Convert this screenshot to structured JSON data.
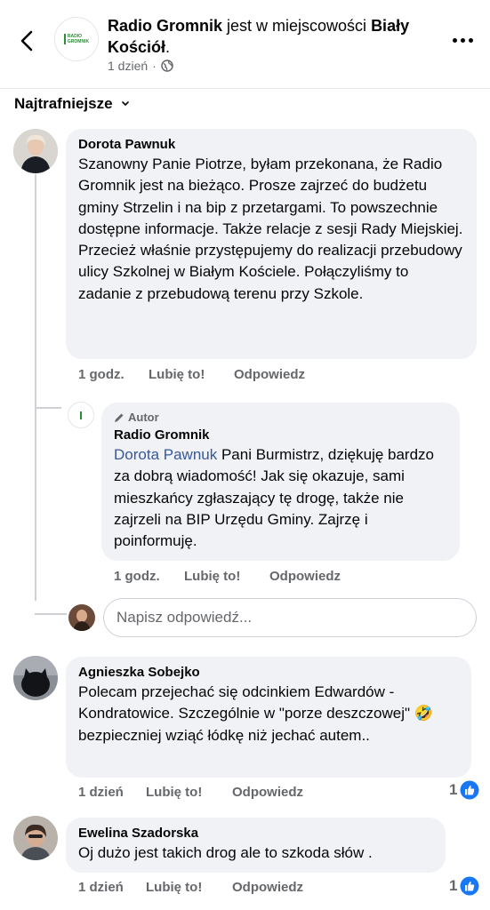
{
  "header": {
    "page_name": "Radio Gromnik",
    "location_text": " jest w miejscowości ",
    "location": "Biały Kościół",
    "time": "1 dzień",
    "dot_sep": "·",
    "logo_line1": "RADIO",
    "logo_line2": "GROMNIK"
  },
  "sort": {
    "label": "Najtrafniejsze"
  },
  "comments": [
    {
      "author": "Dorota Pawnuk",
      "text": "Szanowny Panie Piotrze,  byłam przekonana, że Radio Gromnik jest na bieżąco. Prosze zajrzeć do budżetu gminy Strzelin i na bip z przetargami. To powszechnie dostępne informacje. Także relacje z sesji Rady Miejskiej. Przecież właśnie przystępujemy do realizacji przebudowy ulicy Szkolnej w Białym Kościele. Połączyliśmy to zadanie z przebudową terenu przy Szkole.",
      "time": "1 godz.",
      "like": "Lubię to!",
      "reply": "Odpowiedz"
    },
    {
      "author": "Agnieszka Sobejko",
      "text_before": "Polecam przejechać się odcinkiem Edwardów - Kondratowice. Szczególnie w \"porze deszczowej\" ",
      "emoji": "🤣",
      "text_after": " bezpieczniej wziąć łódkę niż jechać autem..",
      "time": "1 dzień",
      "like": "Lubię to!",
      "reply": "Odpowiedz",
      "reactions": "1"
    },
    {
      "author": "Ewelina Szadorska",
      "text": "Oj dużo jest takich drog ale to szkoda słów .",
      "time": "1 dzień",
      "like": "Lubię to!",
      "reply": "Odpowiedz",
      "reactions": "1"
    }
  ],
  "reply": {
    "badge": "Autor",
    "author": "Radio Gromnik",
    "mention": "Dorota Pawnuk",
    "text": " Pani Burmistrz, dziękuję bardzo za dobrą wiadomość! Jak się okazuje, sami mieszkańcy zgłaszający tę drogę, także nie zajrzeli na BIP Urzędu Gminy. Zajrzę i poinformuję.",
    "time": "1 godz.",
    "like": "Lubię to!",
    "reply": "Odpowiedz"
  },
  "reply_input": {
    "placeholder": "Napisz odpowiedź..."
  },
  "colors": {
    "accent": "#385898",
    "like_blue": "#1877f2",
    "bubble": "#f0f2f5",
    "muted": "#65676b"
  }
}
